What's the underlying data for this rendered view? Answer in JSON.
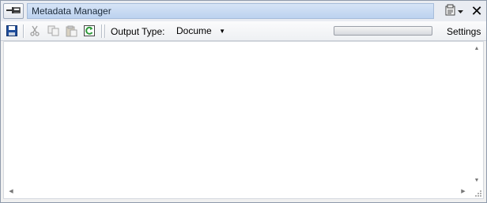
{
  "window": {
    "title": "Metadata Manager"
  },
  "titlebar": {
    "pin_icon": "pin-icon",
    "properties_icon": "properties-dropdown-icon",
    "close_icon": "close-icon",
    "close_glyph": "✕"
  },
  "toolbar": {
    "icons": [
      "save-icon",
      "cut-icon",
      "copy-icon",
      "paste-icon",
      "refresh-icon"
    ],
    "output_type_label": "Output Type:",
    "output_type_value": "Docume",
    "progress": 0,
    "settings_label": "Settings"
  },
  "scrollbars": {
    "up_glyph": "▲",
    "down_glyph": "▼",
    "left_glyph": "◀",
    "right_glyph": "▶"
  },
  "colors": {
    "caption": "#bcd2ef",
    "save": "#1f4e9c",
    "refresh": "#2e9a3a"
  }
}
